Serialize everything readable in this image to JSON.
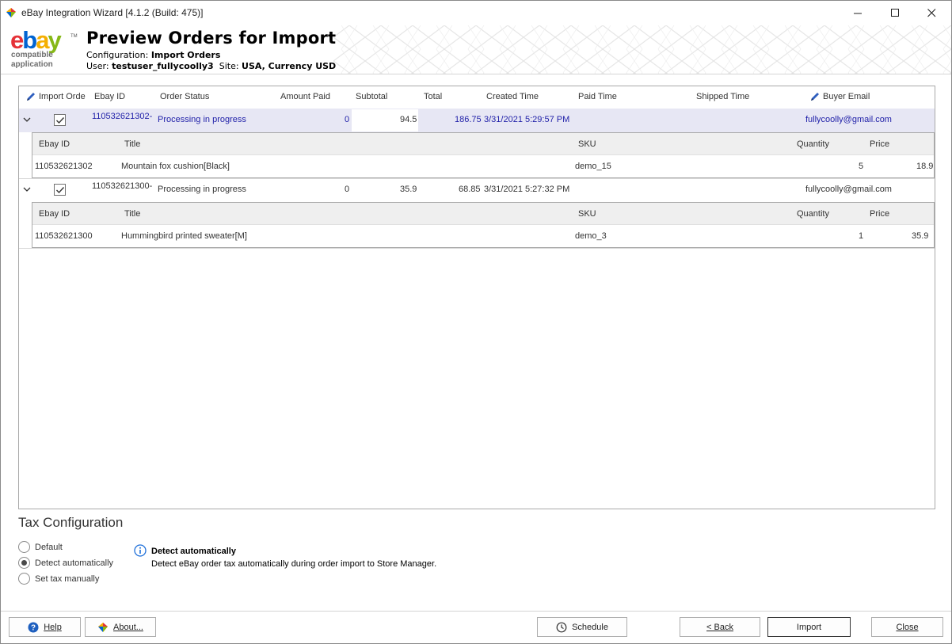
{
  "window": {
    "title": "eBay Integration Wizard [4.1.2 (Build: 475)]"
  },
  "banner": {
    "logo_text": "ebay",
    "logo_sub_line1": "compatible",
    "logo_sub_line2": "application",
    "title": "Preview Orders for Import",
    "config_label": "Configuration:",
    "config_value": "Import Orders",
    "user_label": "User:",
    "user_value": "testuser_fullycoolly3",
    "site_label": "Site:",
    "site_value": "USA, Currency USD"
  },
  "grid": {
    "columns": [
      "Import Orde",
      "Ebay ID",
      "Order Status",
      "Amount Paid",
      "Subtotal",
      "Total",
      "Created Time",
      "Paid Time",
      "Shipped Time",
      "Buyer Email"
    ],
    "sub_columns": [
      "Ebay ID",
      "Title",
      "SKU",
      "Quantity",
      "Price"
    ],
    "orders": [
      {
        "checked": true,
        "ebay_id": "110532621302-",
        "status": "Processing in progress",
        "amount_paid": "0",
        "subtotal": "94.5",
        "total": "186.75",
        "created": "3/31/2021 5:29:57 PM",
        "paid": "",
        "shipped": "",
        "email": "fullycoolly@gmail.com",
        "items": [
          {
            "ebay_id": "110532621302",
            "title": "Mountain fox cushion[Black]",
            "sku": "demo_15",
            "quantity": "5",
            "price": "18.9"
          }
        ]
      },
      {
        "checked": true,
        "ebay_id": "110532621300-",
        "status": "Processing in progress",
        "amount_paid": "0",
        "subtotal": "35.9",
        "total": "68.85",
        "created": "3/31/2021 5:27:32 PM",
        "paid": "",
        "shipped": "",
        "email": "fullycoolly@gmail.com",
        "items": [
          {
            "ebay_id": "110532621300",
            "title": "Hummingbird printed sweater[M]",
            "sku": "demo_3",
            "quantity": "1",
            "price": "35.9"
          }
        ]
      }
    ]
  },
  "tax": {
    "title": "Tax Configuration",
    "options": [
      "Default",
      "Detect automatically",
      "Set tax manually"
    ],
    "selected": "Detect automatically",
    "info_title": "Detect automatically",
    "info_desc": "Detect eBay order tax automatically during order import to Store Manager."
  },
  "buttons": {
    "help": "Help",
    "about": "About...",
    "schedule": "Schedule",
    "back": "< Back",
    "import": "Import",
    "close": "Close"
  },
  "colors": {
    "selected_row_bg": "#e7e7f4",
    "selected_text": "#1f1fa8",
    "info_blue": "#1e6fd9"
  }
}
